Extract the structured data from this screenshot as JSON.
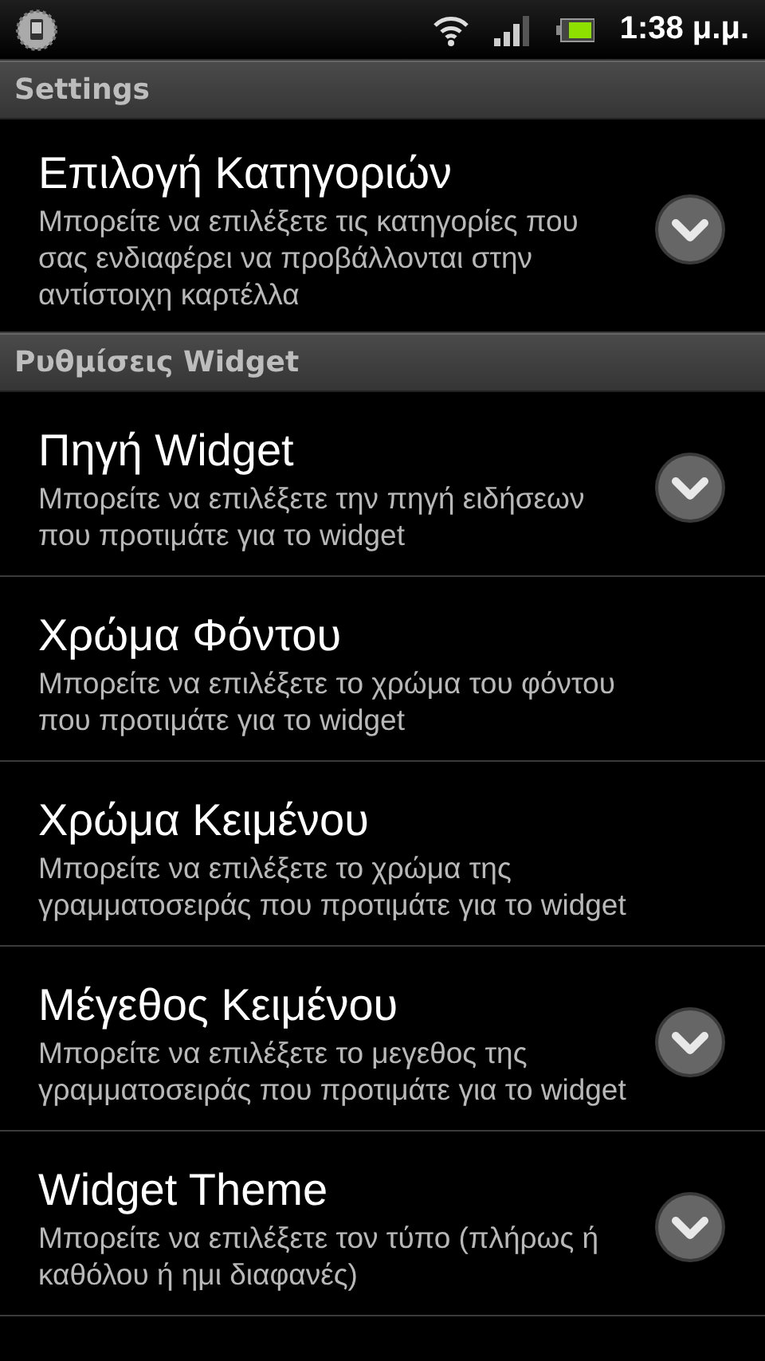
{
  "status_bar": {
    "time": "1:38 μ.μ."
  },
  "sections": [
    {
      "header": "Settings",
      "items": [
        {
          "kind": "dropdown",
          "title": "Επιλογή Κατηγοριών",
          "summary": "Μπορείτε να επιλέξετε τις κατηγορίες που σας ενδιαφέρει να προβάλλονται στην αντίστοιχη καρτέλλα"
        }
      ]
    },
    {
      "header": "Ρυθμίσεις Widget",
      "items": [
        {
          "kind": "dropdown",
          "title": "Πηγή Widget",
          "summary": "Μπορείτε να επιλέξετε την πηγή ειδήσεων που προτιμάτε για το widget"
        },
        {
          "kind": "plain",
          "title": "Χρώμα Φόντου",
          "summary": "Μπορείτε να επιλέξετε το χρώμα του φόντου που προτιμάτε για το widget"
        },
        {
          "kind": "plain",
          "title": "Χρώμα Κειμένου",
          "summary": "Μπορείτε να επιλέξετε το χρώμα της γραμματοσειράς που προτιμάτε για το widget"
        },
        {
          "kind": "dropdown",
          "title": "Μέγεθος Κειμένου",
          "summary": "Μπορείτε να επιλέξετε το μεγεθος της γραμματοσειράς που προτιμάτε για το widget"
        },
        {
          "kind": "dropdown",
          "title": "Widget Theme",
          "summary": "Μπορείτε να επιλέξετε τον τύπο (πλήρως ή καθόλου ή ημι διαφανές)"
        }
      ]
    }
  ]
}
